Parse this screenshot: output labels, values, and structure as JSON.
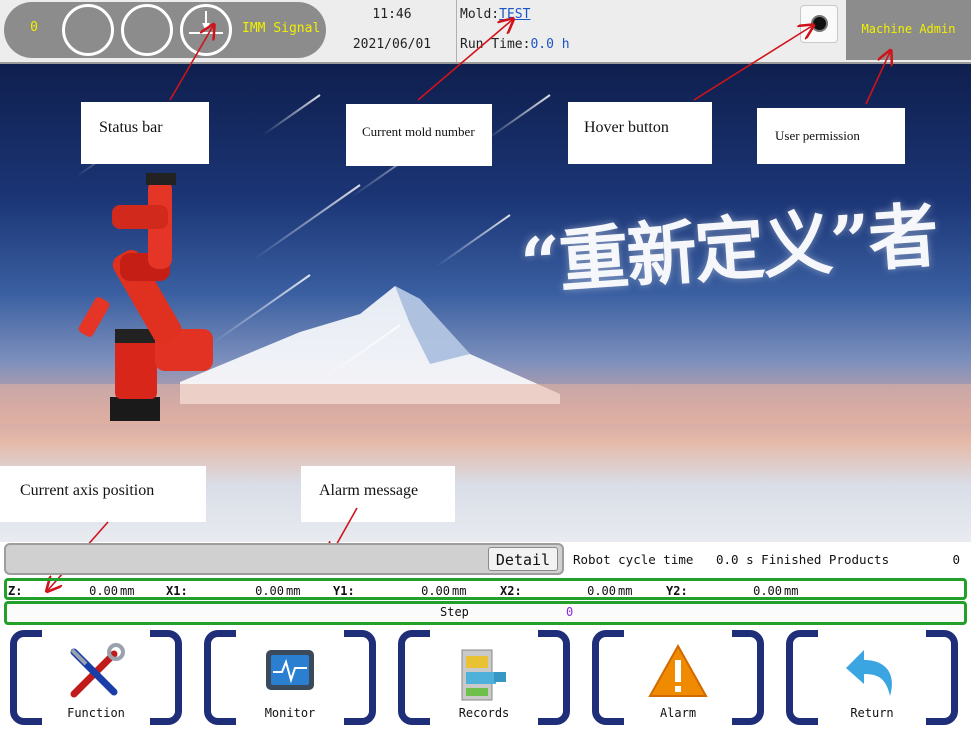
{
  "status_bar": {
    "count": "0",
    "imm_signal_label": "IMM Signal",
    "time": "11:46",
    "date": "2021/06/01",
    "mold_label": "Mold:",
    "mold_value": "TEST",
    "run_time_label": "Run Time:",
    "run_time_value": "0.0 h",
    "user": "Machine Admin"
  },
  "banner": {
    "slogan": "“重新定义”者"
  },
  "callouts": {
    "status_bar": "Status bar",
    "current_mold_number": "Current mold number",
    "hover_button": "Hover button",
    "user_permission": "User permission",
    "current_axis_position": "Current axis position",
    "alarm_message": "Alarm message"
  },
  "alarm": {
    "message": "",
    "detail_button": "Detail"
  },
  "production": {
    "cycle_label": "Robot cycle time",
    "cycle_value": "0.0 s",
    "finished_label": "Finished Products",
    "finished_value": "0"
  },
  "axes": [
    {
      "name": "Z:",
      "value": "0.00",
      "unit": "mm"
    },
    {
      "name": "X1:",
      "value": "0.00",
      "unit": "mm"
    },
    {
      "name": "Y1:",
      "value": "0.00",
      "unit": "mm"
    },
    {
      "name": "X2:",
      "value": "0.00",
      "unit": "mm"
    },
    {
      "name": "Y2:",
      "value": "0.00",
      "unit": "mm"
    }
  ],
  "step": {
    "label": "Step",
    "value": "0"
  },
  "nav": [
    {
      "label": "Function",
      "icon": "tools-icon"
    },
    {
      "label": "Monitor",
      "icon": "monitor-icon"
    },
    {
      "label": "Records",
      "icon": "file-cabinet-icon"
    },
    {
      "label": "Alarm",
      "icon": "warning-icon"
    },
    {
      "label": "Return",
      "icon": "return-arrow-icon"
    }
  ],
  "colors": {
    "status_text": "#f0f000",
    "accent_green": "#22a02a",
    "nav_frame": "#1f2e78",
    "link_blue": "#1a55c8"
  }
}
